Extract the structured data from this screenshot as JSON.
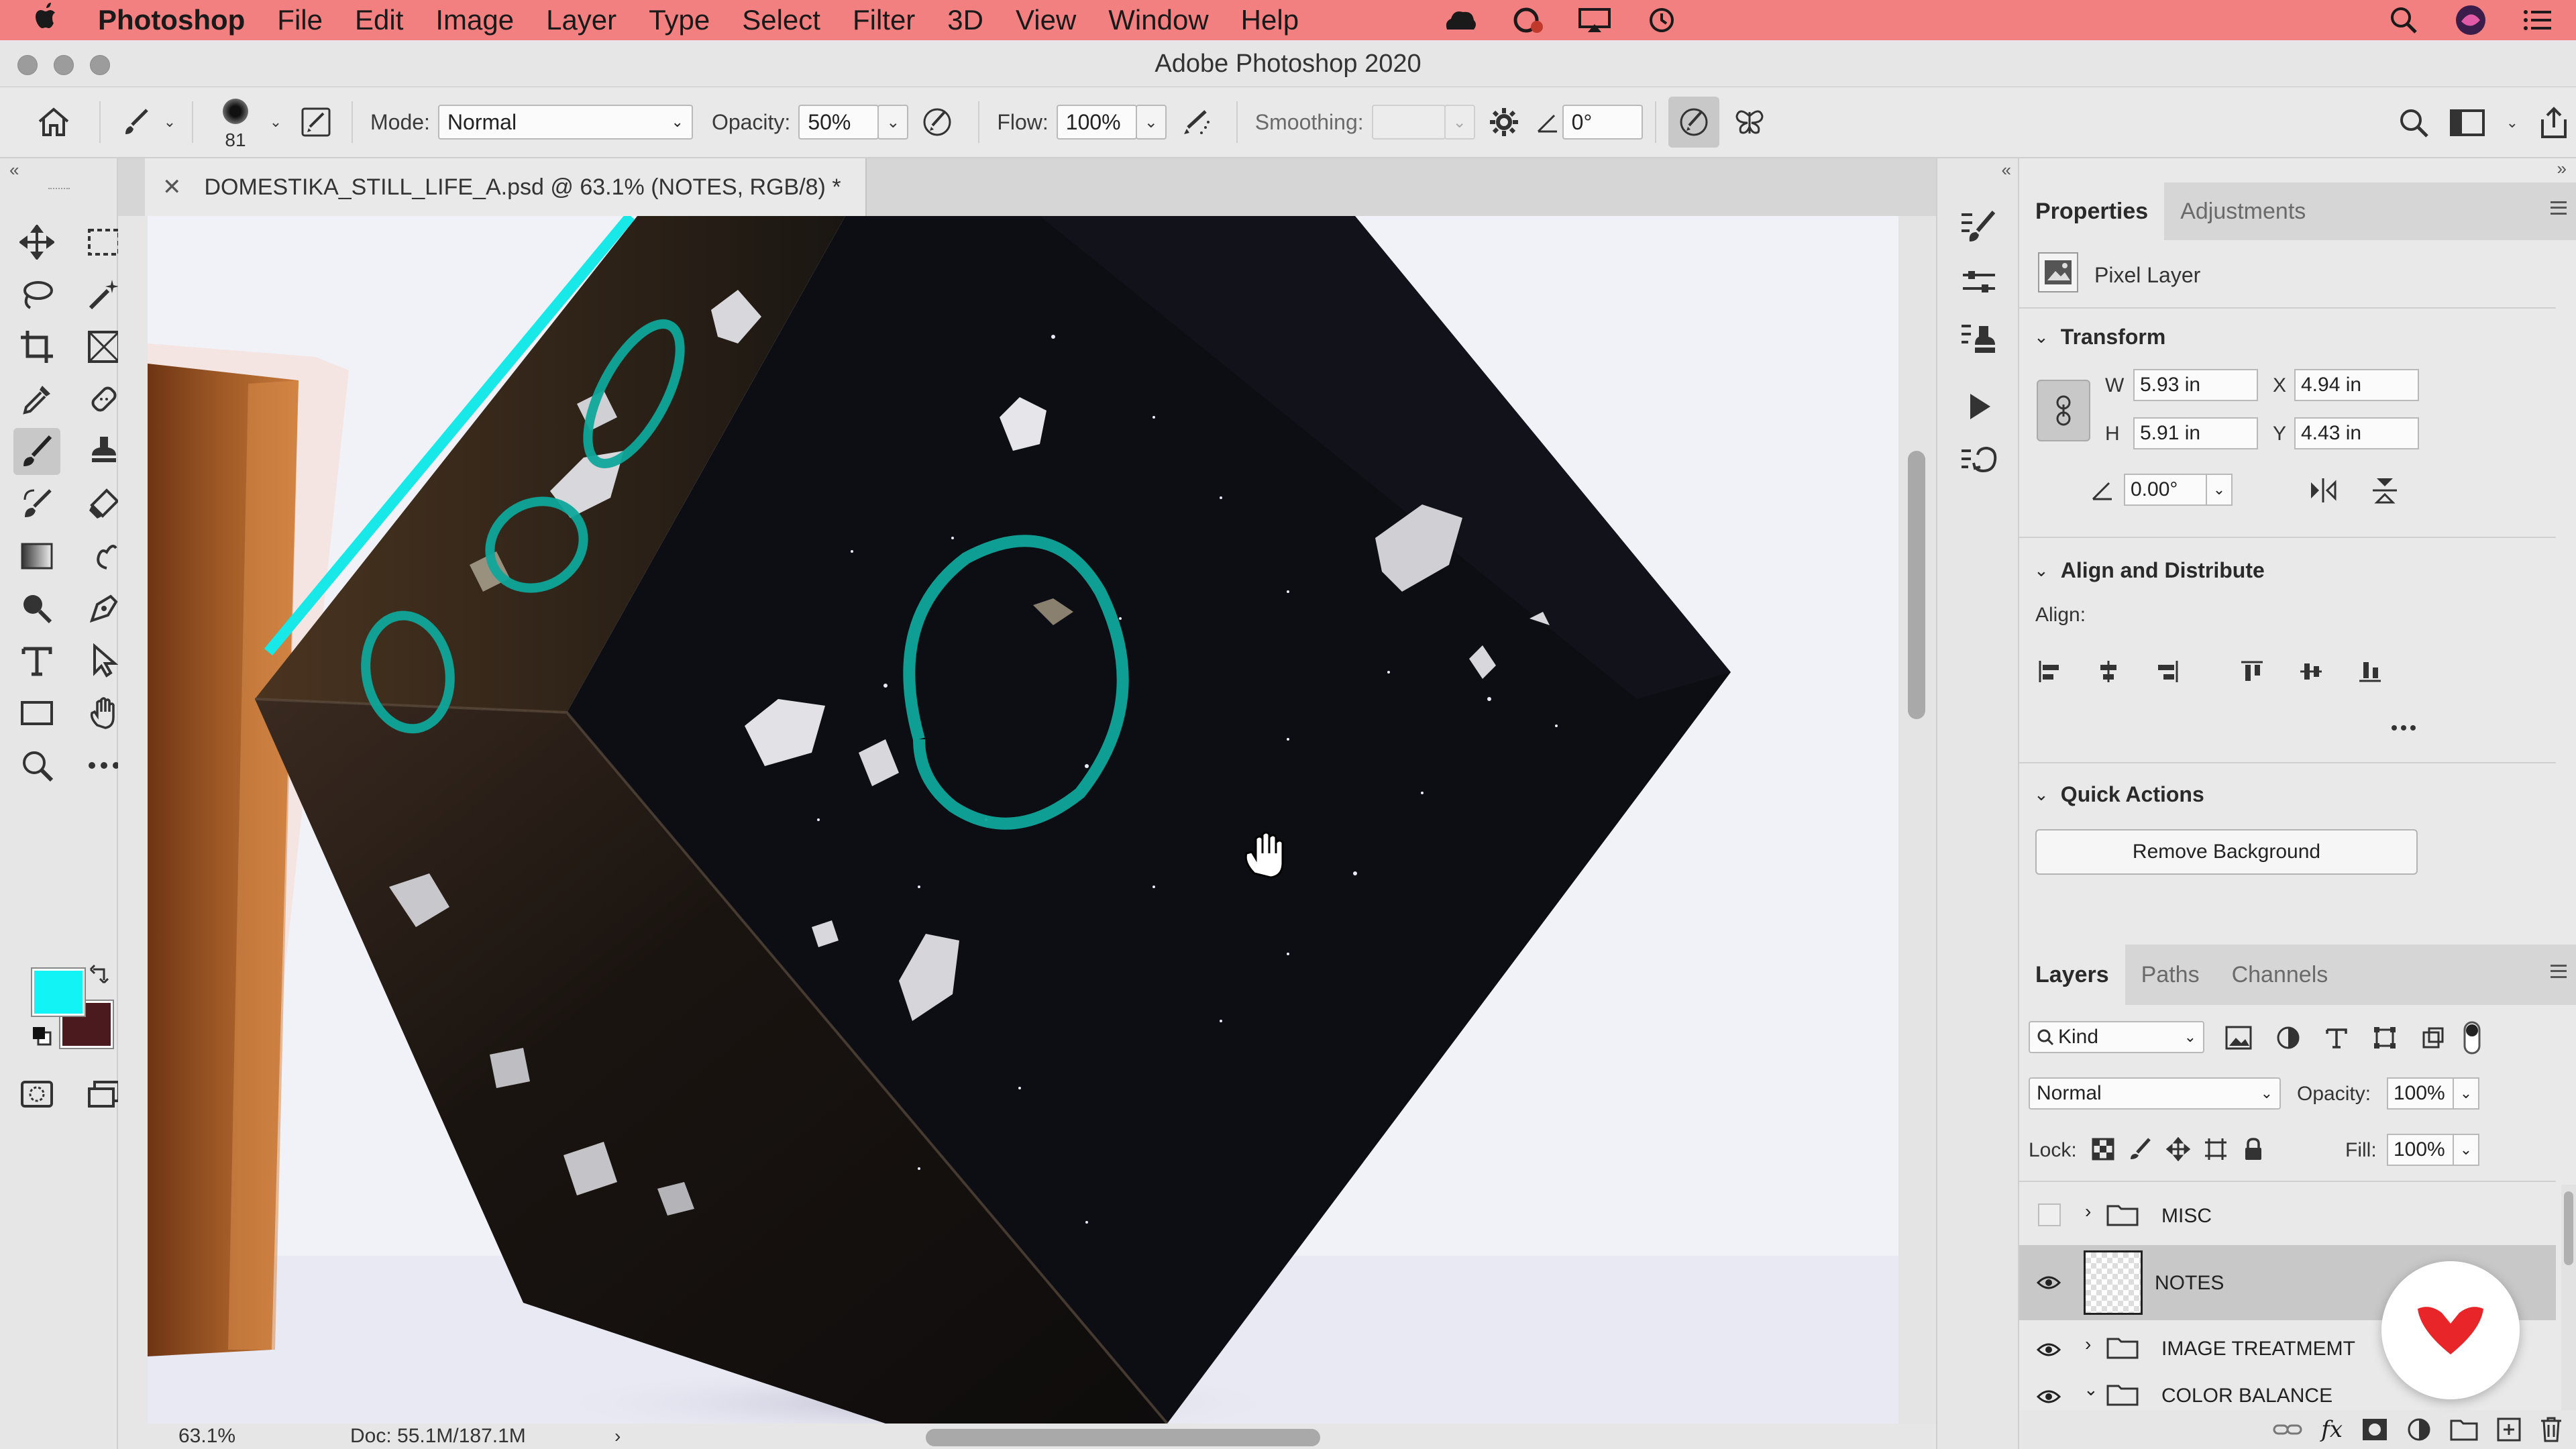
{
  "menubar": {
    "app_name": "Photoshop",
    "items": [
      "File",
      "Edit",
      "Image",
      "Layer",
      "Type",
      "Select",
      "Filter",
      "3D",
      "View",
      "Window",
      "Help"
    ]
  },
  "window": {
    "title": "Adobe Photoshop 2020"
  },
  "options": {
    "brush_size": "81",
    "mode_label": "Mode:",
    "mode_value": "Normal",
    "opacity_label": "Opacity:",
    "opacity_value": "50%",
    "flow_label": "Flow:",
    "flow_value": "100%",
    "smoothing_label": "Smoothing:",
    "smoothing_value": "",
    "angle_value": "0°"
  },
  "document": {
    "tab_label": "DOMESTIKA_STILL_LIFE_A.psd @ 63.1% (NOTES, RGB/8) *",
    "zoom": "63.1%",
    "doc_info": "Doc: 55.1M/187.1M"
  },
  "colors": {
    "foreground": "#12f3f5",
    "background": "#4a1a1e",
    "menubar": "#f28080",
    "annotation_teal": "#0fa79a",
    "selection_line": "#19e8e8"
  },
  "properties": {
    "tabs": [
      "Properties",
      "Adjustments"
    ],
    "layer_type": "Pixel Layer",
    "transform_heading": "Transform",
    "w_label": "W",
    "w_value": "5.93 in",
    "h_label": "H",
    "h_value": "5.91 in",
    "x_label": "X",
    "x_value": "4.94 in",
    "y_label": "Y",
    "y_value": "4.43 in",
    "angle_value": "0.00°",
    "align_heading": "Align and Distribute",
    "align_label": "Align:",
    "quick_actions_heading": "Quick Actions",
    "remove_bg_label": "Remove Background"
  },
  "layers": {
    "tabs": [
      "Layers",
      "Paths",
      "Channels"
    ],
    "filter_kind": "Kind",
    "blend_mode": "Normal",
    "opacity_label": "Opacity:",
    "opacity_value": "100%",
    "lock_label": "Lock:",
    "fill_label": "Fill:",
    "fill_value": "100%",
    "items": [
      {
        "name": "MISC",
        "type": "group",
        "visible": false
      },
      {
        "name": "NOTES",
        "type": "pixel",
        "visible": true,
        "selected": true
      },
      {
        "name": "IMAGE TREATMEMT",
        "type": "group",
        "visible": true
      },
      {
        "name": "COLOR BALANCE",
        "type": "group",
        "visible": true,
        "expanded": true
      }
    ]
  }
}
